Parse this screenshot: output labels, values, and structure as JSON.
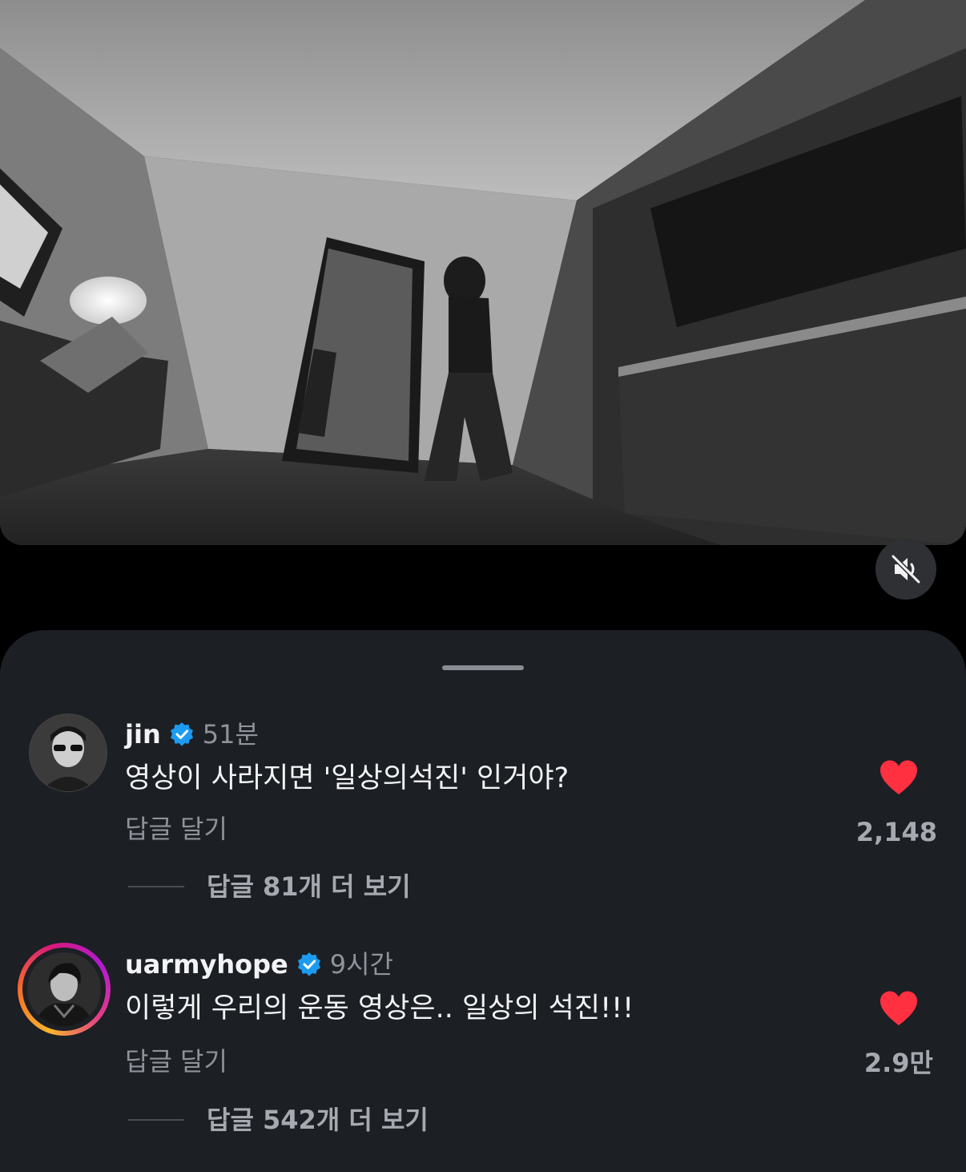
{
  "video": {
    "mute_icon": "speaker-muted-icon"
  },
  "comments": [
    {
      "username": "jin",
      "verified": true,
      "timestamp": "51분",
      "text": "영상이 사라지면 '일상의석진' 인거야?",
      "reply_label": "답글 달기",
      "likes": "2,148",
      "liked": true,
      "more_replies": "답글 81개 더 보기"
    },
    {
      "username": "uarmyhope",
      "verified": true,
      "timestamp": "9시간",
      "text": "이렇게 우리의 운동 영상은.. 일상의 석진!!!",
      "reply_label": "답글 달기",
      "likes": "2.9만",
      "liked": true,
      "more_replies": "답글 542개 더 보기",
      "story_ring": true
    }
  ],
  "colors": {
    "sheet_bg": "#1c1f24",
    "heart": "#ff3040",
    "verified": "#1d9bf0"
  }
}
